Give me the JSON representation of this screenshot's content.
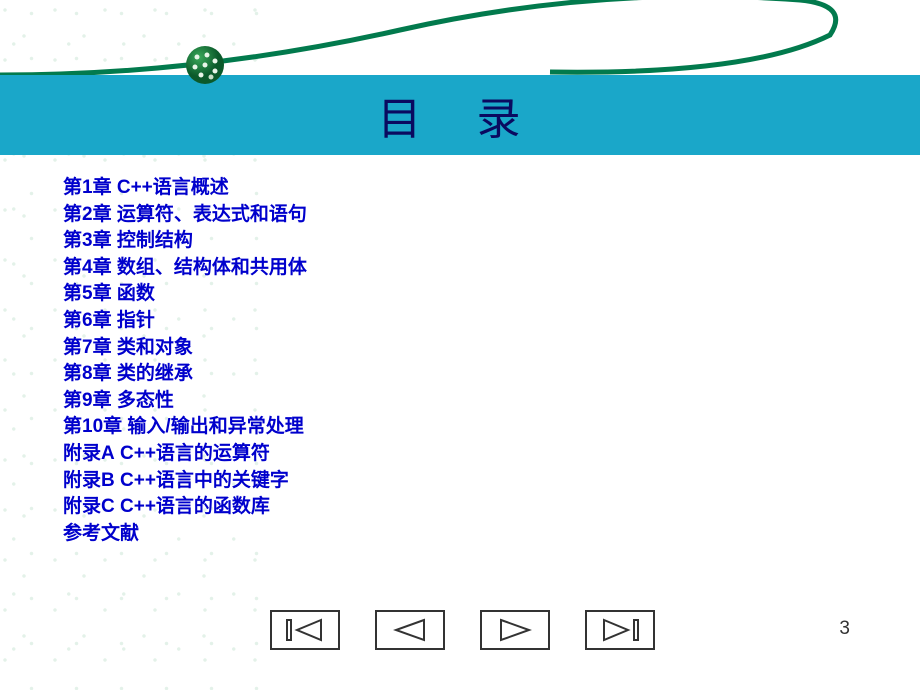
{
  "title": "目  录",
  "toc": [
    {
      "chapter": "第1章",
      "name": "C++语言概述"
    },
    {
      "chapter": "第2章",
      "name": "运算符、表达式和语句"
    },
    {
      "chapter": "第3章",
      "name": "控制结构"
    },
    {
      "chapter": "第4章",
      "name": "数组、结构体和共用体"
    },
    {
      "chapter": "第5章",
      "name": "函数"
    },
    {
      "chapter": "第6章",
      "name": "指针"
    },
    {
      "chapter": "第7章",
      "name": "类和对象"
    },
    {
      "chapter": "第8章",
      "name": "类的继承"
    },
    {
      "chapter": "第9章",
      "name": "多态性"
    },
    {
      "chapter": "第10章",
      "name": "输入/输出和异常处理"
    },
    {
      "chapter": "附录A",
      "name": "C++语言的运算符"
    },
    {
      "chapter": "附录B",
      "name": "C++语言中的关键字"
    },
    {
      "chapter": "附录C",
      "name": "C++语言的函数库"
    },
    {
      "chapter": "参考文献",
      "name": ""
    }
  ],
  "pageNumber": "3",
  "colors": {
    "titleBar": "#1aa7c9",
    "link": "#0000cc",
    "curve": "#027a4d"
  }
}
